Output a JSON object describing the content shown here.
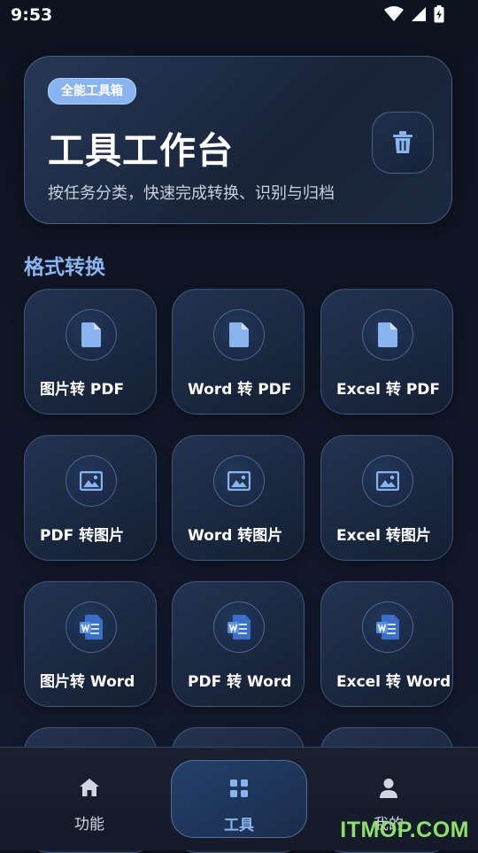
{
  "status_bar": {
    "time": "9:53"
  },
  "hero": {
    "badge": "全能工具箱",
    "title": "工具工作台",
    "subtitle": "按任务分类，快速完成转换、识别与归档"
  },
  "section": {
    "title": "格式转换"
  },
  "tools": [
    {
      "label": "图片转 PDF",
      "icon": "document-icon"
    },
    {
      "label": "Word 转 PDF",
      "icon": "document-icon"
    },
    {
      "label": "Excel 转 PDF",
      "icon": "document-icon"
    },
    {
      "label": "PDF 转图片",
      "icon": "image-icon"
    },
    {
      "label": "Word 转图片",
      "icon": "image-icon"
    },
    {
      "label": "Excel 转图片",
      "icon": "image-icon"
    },
    {
      "label": "图片转 Word",
      "icon": "word-icon"
    },
    {
      "label": "PDF 转 Word",
      "icon": "word-icon"
    },
    {
      "label": "Excel 转 Word",
      "icon": "word-icon"
    }
  ],
  "nav": [
    {
      "label": "功能",
      "icon": "home-icon"
    },
    {
      "label": "工具",
      "icon": "grid-icon",
      "active": true
    },
    {
      "label": "我的",
      "icon": "person-icon"
    }
  ],
  "watermark": "ITMOP.COM",
  "colors": {
    "accent": "#8ab4f0",
    "background": "#101626",
    "watermark": "#8fe06a"
  }
}
